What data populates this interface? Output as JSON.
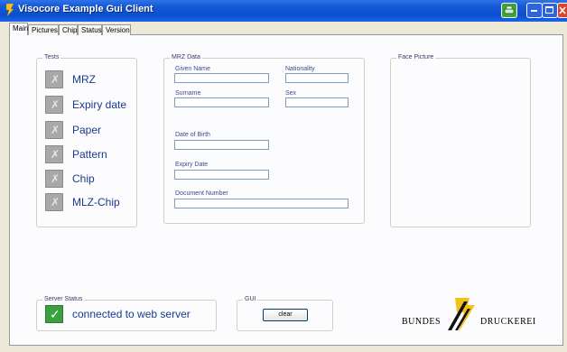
{
  "window": {
    "title": "Visocore Example Gui Client"
  },
  "tabs": [
    {
      "label": "Main"
    },
    {
      "label": "Pictures"
    },
    {
      "label": "Chip"
    },
    {
      "label": "Status"
    },
    {
      "label": "Version"
    }
  ],
  "tests": {
    "group_label": "Tests",
    "items": [
      {
        "label": "MRZ"
      },
      {
        "label": "Expiry date"
      },
      {
        "label": "Paper"
      },
      {
        "label": "Pattern"
      },
      {
        "label": "Chip"
      },
      {
        "label": "MLZ-Chip"
      }
    ]
  },
  "mrz": {
    "group_label": "MRZ Data",
    "given_name": {
      "label": "Given Name",
      "value": ""
    },
    "nationality": {
      "label": "Nationality",
      "value": ""
    },
    "surname": {
      "label": "Surname",
      "value": ""
    },
    "sex": {
      "label": "Sex",
      "value": ""
    },
    "date_of_birth": {
      "label": "Date of Birth",
      "value": ""
    },
    "expiry_date": {
      "label": "Expiry Date",
      "value": ""
    },
    "document_number": {
      "label": "Document Number",
      "value": ""
    }
  },
  "face": {
    "group_label": "Face Picture"
  },
  "server_status": {
    "group_label": "Server Status",
    "text": "connected to web server"
  },
  "gui": {
    "group_label": "GUI",
    "clear_label": "clear"
  },
  "logo": {
    "left": "BUNDES",
    "right": "DRUCKEREI"
  },
  "colors": {
    "title_bar": "#0a4fd0",
    "status_ok": "#3aa040",
    "test_pending": "#a8a8a8",
    "label_text": "#1a3a8a"
  },
  "icons": {
    "test_status": "x-mark-icon",
    "server_status": "checkmark-icon"
  }
}
